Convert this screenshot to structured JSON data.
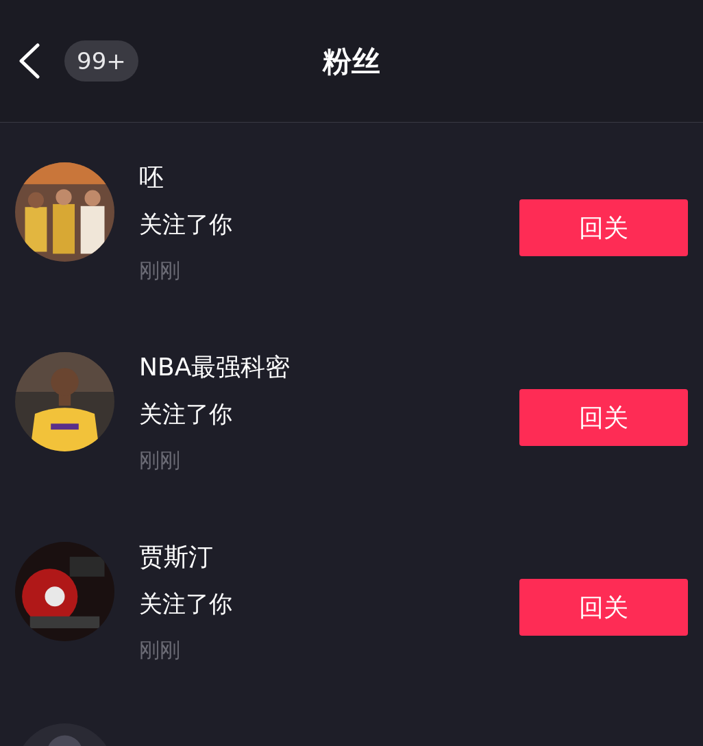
{
  "header": {
    "badge": "99+",
    "title": "粉丝"
  },
  "followers": [
    {
      "name": "呸",
      "action": "关注了你",
      "time": "刚刚",
      "button": "回关"
    },
    {
      "name": "NBA最强科密",
      "action": "关注了你",
      "time": "刚刚",
      "button": "回关"
    },
    {
      "name": "贾斯汀",
      "action": "关注了你",
      "time": "刚刚",
      "button": "回关"
    }
  ]
}
